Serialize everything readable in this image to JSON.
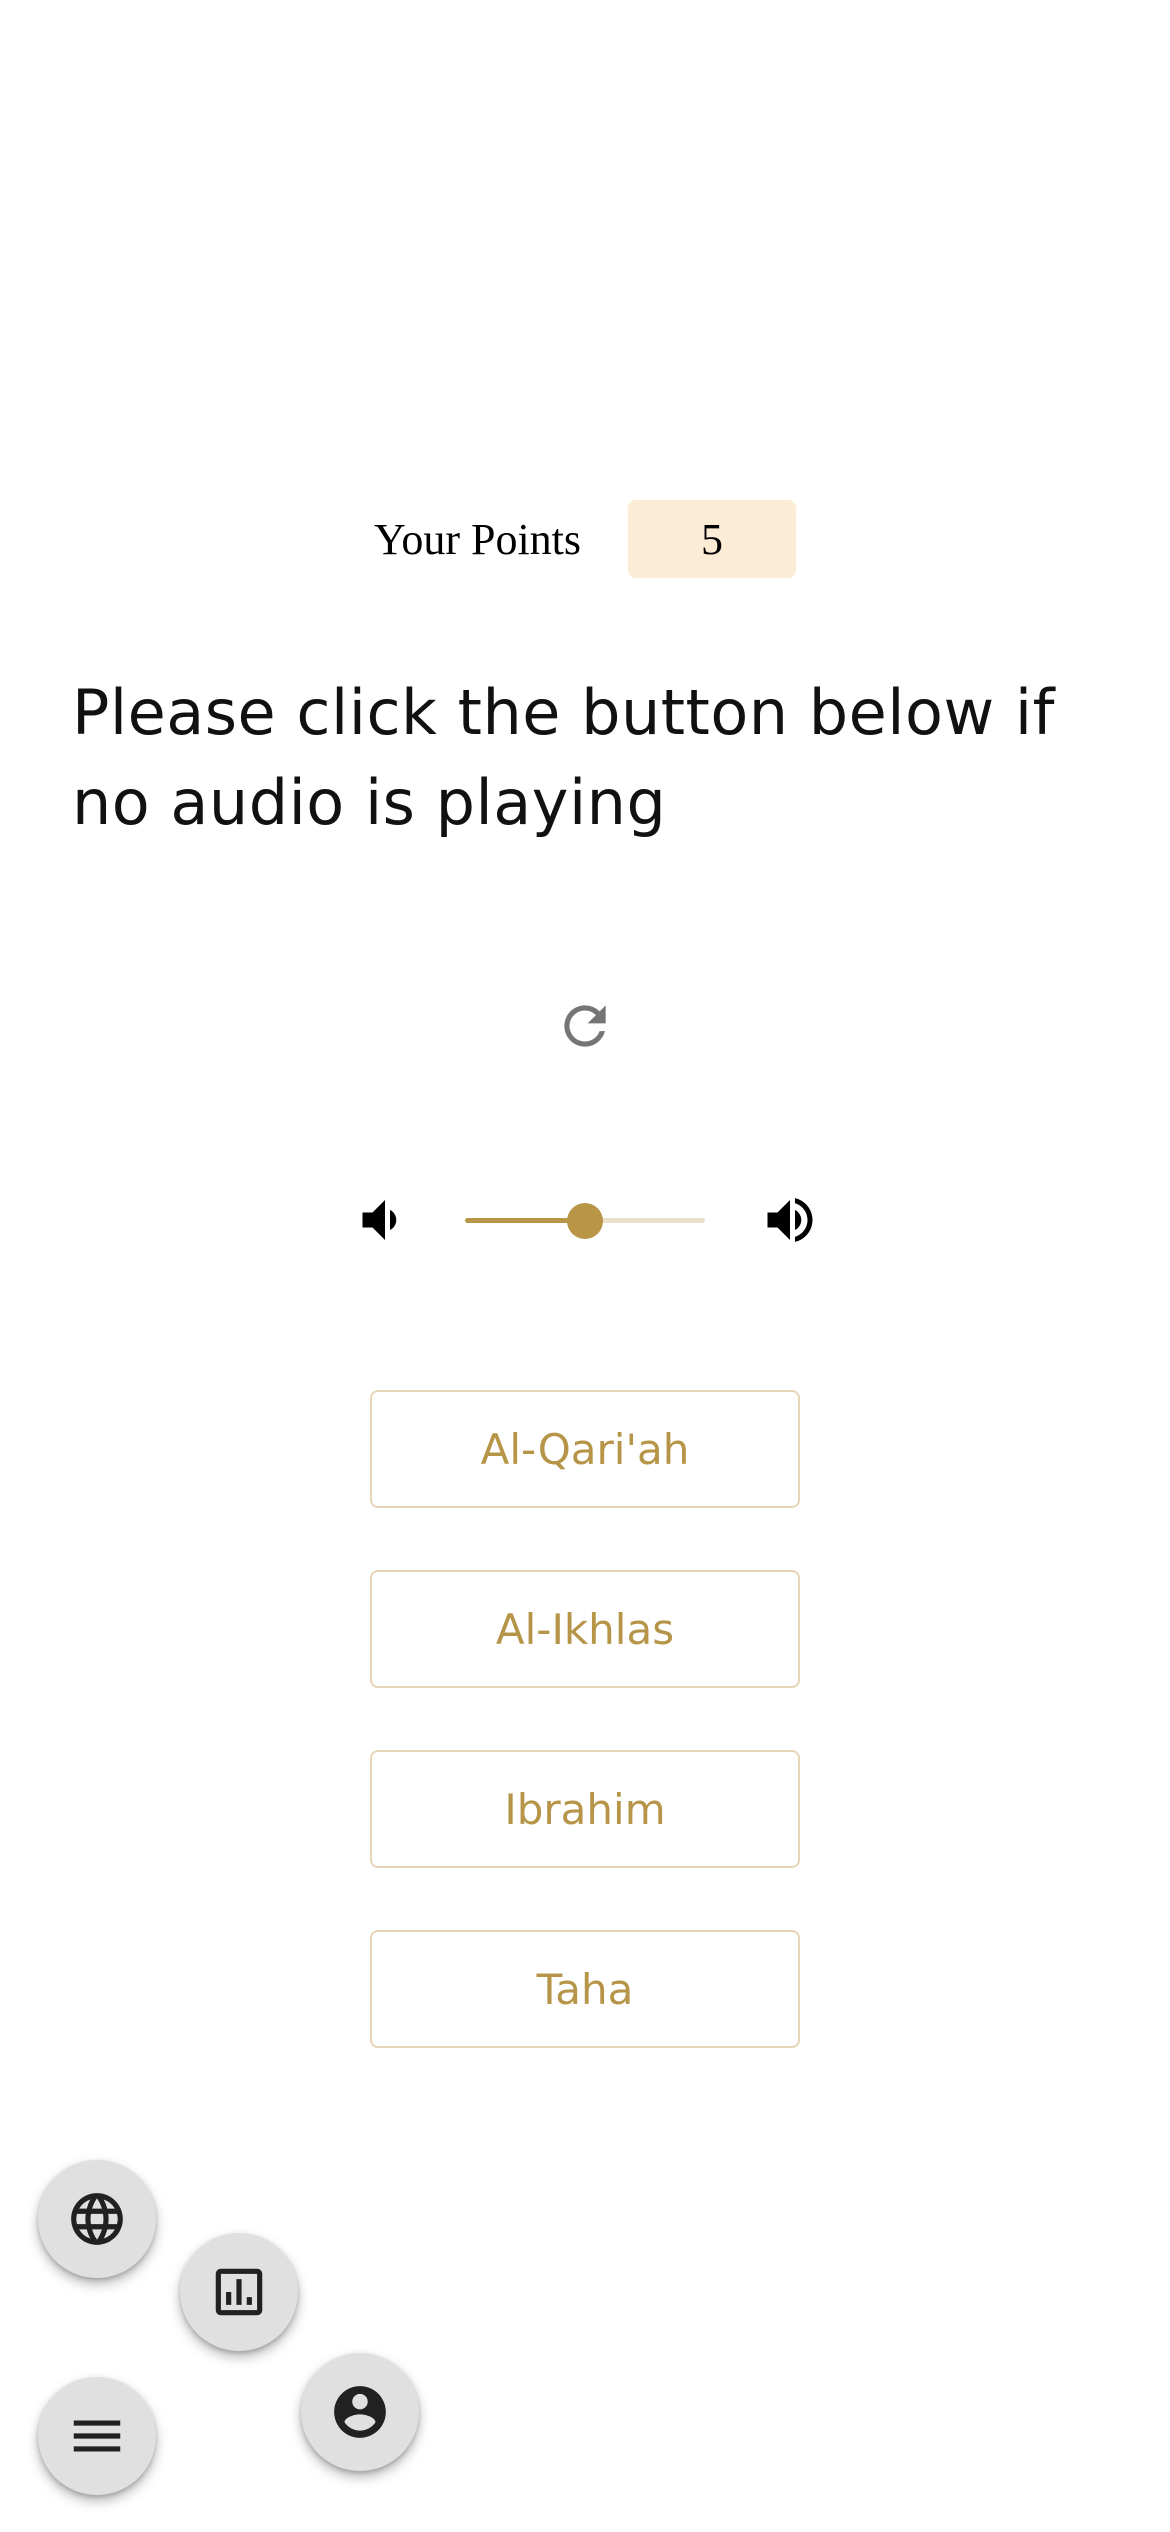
{
  "points": {
    "label": "Your Points",
    "value": "5"
  },
  "prompt": {
    "text": "Please click the button below if no audio is playing"
  },
  "icons": {
    "replay": "replay-icon",
    "volume_low": "volume-down-icon",
    "volume_high": "volume-up-icon",
    "language": "globe-icon",
    "stats": "bar-chart-icon",
    "menu": "hamburger-menu-icon",
    "profile": "account-circle-icon"
  },
  "volume": {
    "level": 0.5
  },
  "choices": [
    {
      "label": "Al-Qari'ah"
    },
    {
      "label": "Al-Ikhlas"
    },
    {
      "label": "Ibrahim"
    },
    {
      "label": "Taha"
    }
  ],
  "colors": {
    "accent": "#b99548",
    "accent_light": "#eadfc8",
    "points_bg": "#fcebd5",
    "choice_border": "#e6d6b8",
    "choice_text": "#b69548",
    "fab_bg": "#e0e0e0"
  }
}
